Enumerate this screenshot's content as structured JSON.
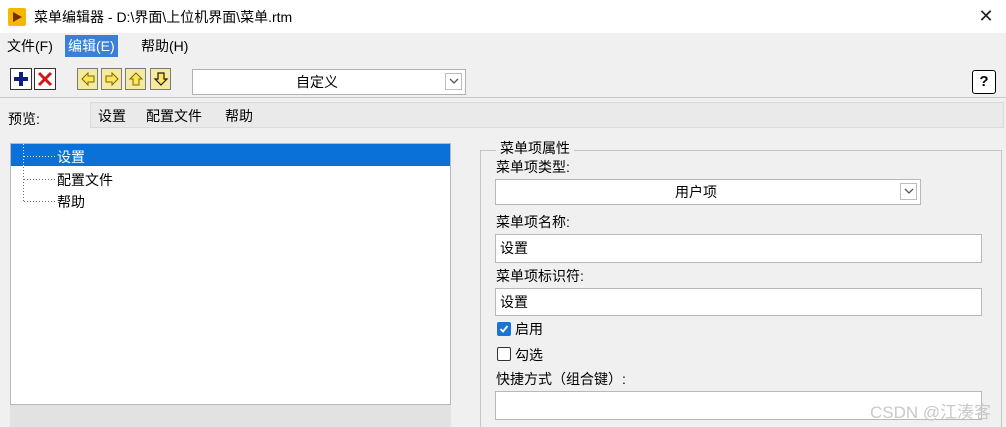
{
  "window": {
    "title": "菜单编辑器 - D:\\界面\\上位机界面\\菜单.rtm",
    "close_glyph": "✕"
  },
  "menubar": {
    "items": [
      {
        "label": "文件(F)"
      },
      {
        "label": "编辑(E)"
      },
      {
        "label": "帮助(H)"
      }
    ]
  },
  "toolbar": {
    "preset": "自定义",
    "help_glyph": "?",
    "icons": [
      "plus-icon",
      "delete-icon",
      "arrow-left-icon",
      "arrow-right-icon",
      "arrow-up-icon",
      "arrow-down-icon"
    ]
  },
  "preview": {
    "label": "预览:",
    "items": [
      "设置",
      "配置文件",
      "帮助"
    ]
  },
  "tree": {
    "items": [
      {
        "label": "设置",
        "selected": true
      },
      {
        "label": "配置文件",
        "selected": false
      },
      {
        "label": "帮助",
        "selected": false
      }
    ]
  },
  "properties": {
    "group_title": "菜单项属性",
    "type_label": "菜单项类型:",
    "type_value": "用户项",
    "name_label": "菜单项名称:",
    "name_value": "设置",
    "id_label": "菜单项标识符:",
    "id_value": "设置",
    "enabled_label": "启用",
    "enabled": true,
    "checked_label": "勾选",
    "checked": false,
    "shortcut_label": "快捷方式（组合键）:",
    "shortcut_value": ""
  },
  "watermark": "CSDN @江湊客",
  "colors": {
    "selection": "#0a71d8",
    "menu_active": "#3c7fd6",
    "app_icon": "#f5b800"
  }
}
